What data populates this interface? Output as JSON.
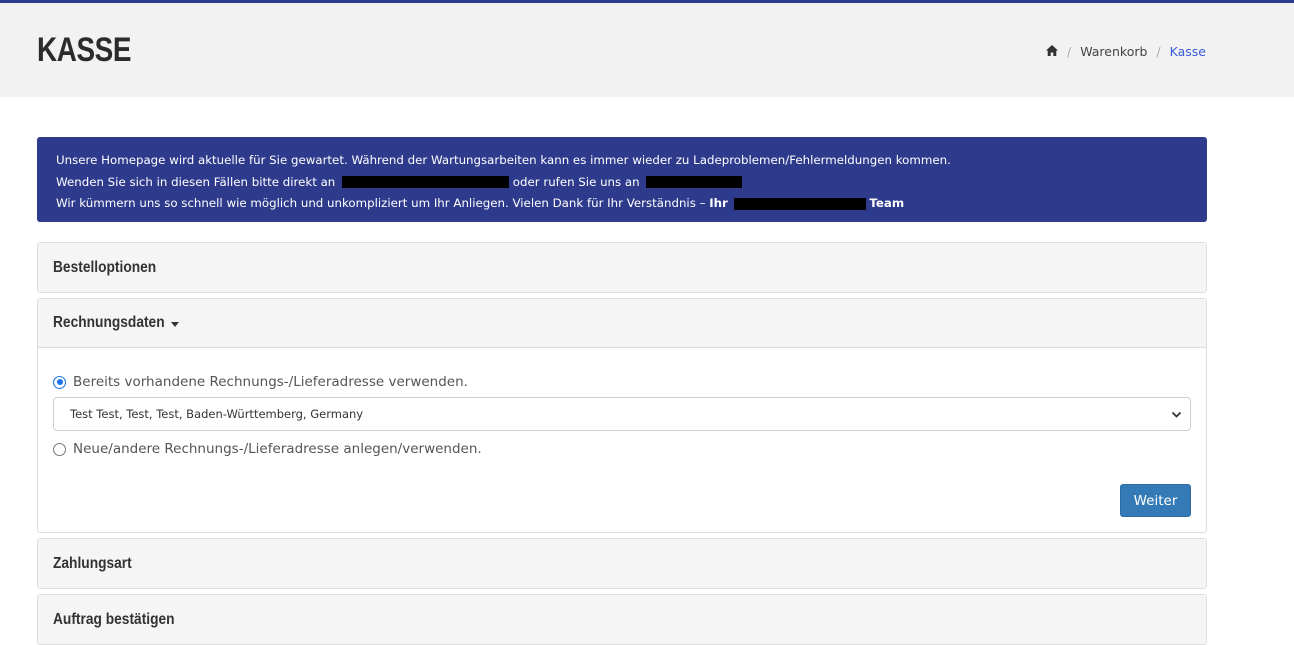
{
  "header": {
    "title": "KASSE",
    "breadcrumb": {
      "home_icon": "home-icon",
      "items": [
        "Warenkorb",
        "Kasse"
      ]
    }
  },
  "notice": {
    "line1": "Unsere Homepage wird aktuelle für Sie gewartet. Während der Wartungsarbeiten kann es immer wieder zu Ladeproblemen/Fehlermeldungen kommen.",
    "line2_a": "Wenden Sie sich in diesen Fällen bitte direkt an",
    "line2_b": "oder rufen Sie uns an",
    "line3_a": "Wir kümmern uns so schnell wie möglich und unkompliziert um Ihr Anliegen. Vielen Dank für Ihr Verständnis –",
    "line3_b": "Ihr",
    "line3_c": "Team"
  },
  "panels": {
    "bestelloptionen": "Bestelloptionen",
    "rechnungsdaten": "Rechnungsdaten",
    "zahlungsart": "Zahlungsart",
    "auftrag": "Auftrag bestätigen"
  },
  "rechnungsdaten": {
    "option_existing": "Bereits vorhandene Rechnungs-/Lieferadresse verwenden.",
    "selected_address": "Test Test, Test, Test, Baden-Württemberg, Germany",
    "option_new": "Neue/andere Rechnungs-/Lieferadresse anlegen/verwenden.",
    "continue_label": "Weiter"
  },
  "colors": {
    "accent": "#2e3a8c",
    "button": "#337ab7",
    "breadcrumb_active": "#3b5bdb"
  }
}
